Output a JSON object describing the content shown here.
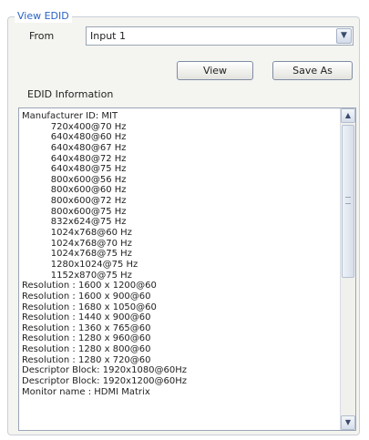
{
  "group_title": "View EDID",
  "from": {
    "label": "From",
    "selected": "Input 1"
  },
  "buttons": {
    "view": "View",
    "save_as": "Save As"
  },
  "edid_info": {
    "label": "EDID Information",
    "lines": [
      "Manufacturer ID: MIT",
      "          720x400@70 Hz",
      "          640x480@60 Hz",
      "          640x480@67 Hz",
      "          640x480@72 Hz",
      "          640x480@75 Hz",
      "          800x600@56 Hz",
      "          800x600@60 Hz",
      "          800x600@72 Hz",
      "          800x600@75 Hz",
      "          832x624@75 Hz",
      "          1024x768@60 Hz",
      "          1024x768@70 Hz",
      "          1024x768@75 Hz",
      "          1280x1024@75 Hz",
      "          1152x870@75 Hz",
      "Resolution : 1600 x 1200@60",
      "Resolution : 1600 x 900@60",
      "Resolution : 1680 x 1050@60",
      "Resolution : 1440 x 900@60",
      "Resolution : 1360 x 765@60",
      "Resolution : 1280 x 960@60",
      "Resolution : 1280 x 800@60",
      "Resolution : 1280 x 720@60",
      "Descriptor Block: 1920x1080@60Hz",
      "Descriptor Block: 1920x1200@60Hz",
      "Monitor name : HDMI Matrix"
    ]
  },
  "icons": {
    "dropdown": "chevron-down-icon",
    "scroll_up": "chevron-up-icon",
    "scroll_down": "chevron-down-icon"
  },
  "colors": {
    "group_title": "#2a63c8",
    "group_background": "#f4f4f0"
  }
}
